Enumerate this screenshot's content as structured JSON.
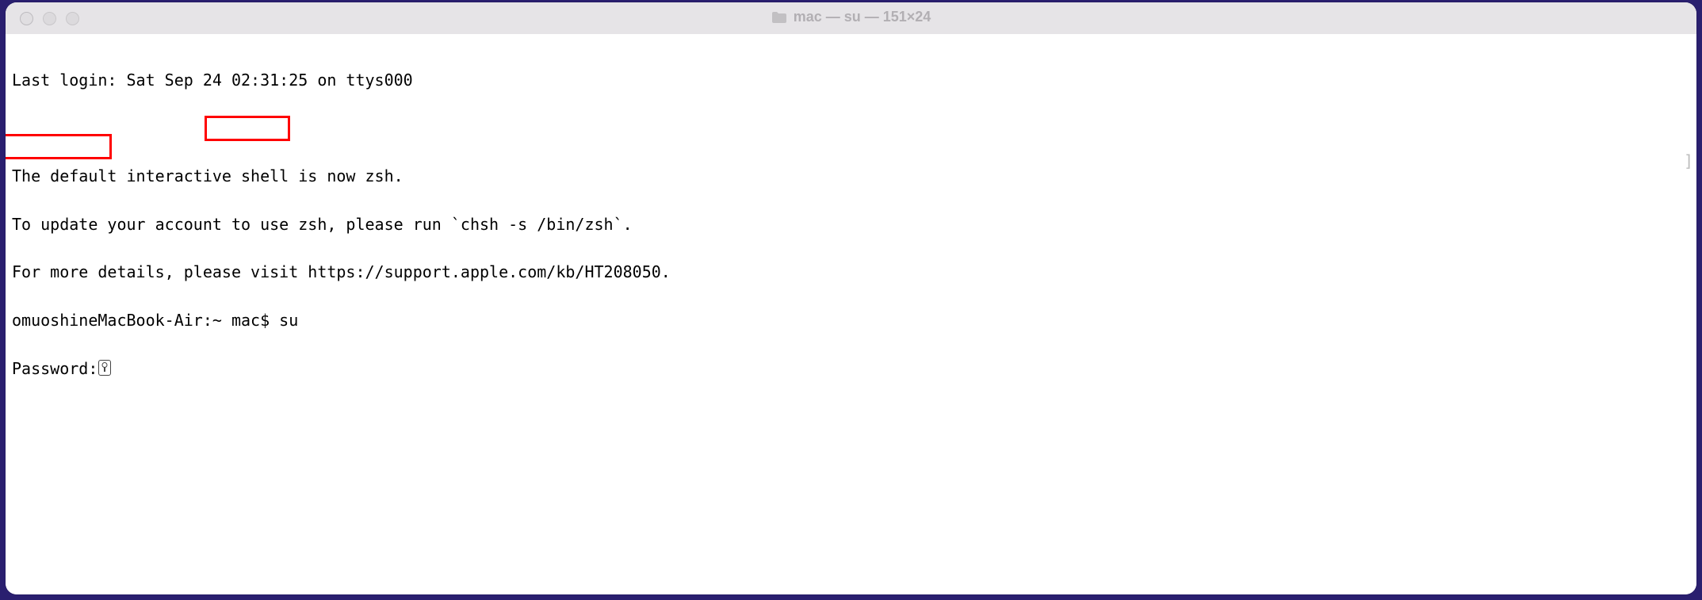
{
  "window": {
    "title": "mac — su — 151×24"
  },
  "terminal": {
    "lines": {
      "last_login": "Last login: Sat Sep 24 02:31:25 on ttys000",
      "blank": "",
      "zsh_notice_1": "The default interactive shell is now zsh.",
      "zsh_notice_2": "To update your account to use zsh, please run `chsh -s /bin/zsh`.",
      "zsh_notice_3": "For more details, please visit https://support.apple.com/kb/HT208050.",
      "prompt": "omuoshineMacBook-Air:~ mac$ su",
      "password": "Password:"
    }
  },
  "icons": {
    "folder": "folder-icon",
    "key": "key-icon"
  }
}
